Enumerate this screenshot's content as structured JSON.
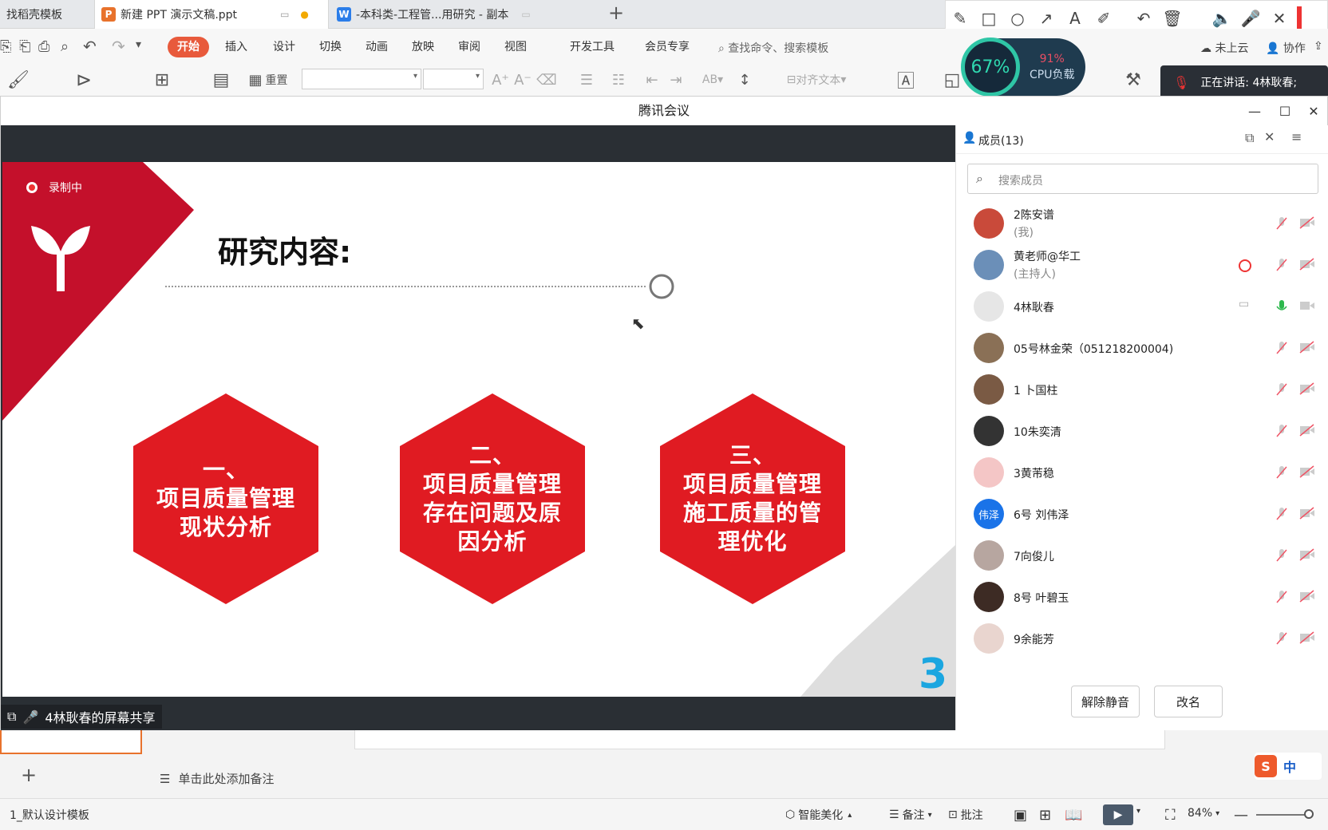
{
  "tabs": [
    {
      "label": "找稻壳模板"
    },
    {
      "label": "新建 PPT 演示文稿.ppt",
      "icon": "P"
    },
    {
      "label": "-本科类-工程管...用研究 - 副本",
      "icon": "W"
    }
  ],
  "menu": [
    "开始",
    "插入",
    "设计",
    "切换",
    "动画",
    "放映",
    "审阅",
    "视图",
    "开发工具",
    "会员专享"
  ],
  "search_cmd": "查找命令、搜索模板",
  "cloud": "未上云",
  "collab": "协作",
  "ribbon": {
    "reset": "重置",
    "align_text": "对齐文本"
  },
  "cpu": {
    "percent": "67%",
    "load": "91%",
    "load_label": "CPU负载"
  },
  "speaking": "正在讲话: 4林耿春;",
  "meeting": {
    "title": "腾讯会议",
    "recording": "录制中",
    "share_label": "4林耿春的屏幕共享"
  },
  "slide": {
    "title": "研究内容:",
    "page_number": "3",
    "hexes": [
      {
        "l1": "一、",
        "l2": "项目质量管理",
        "l3": "现状分析",
        "l4": ""
      },
      {
        "l1": "二、",
        "l2": "项目质量管理",
        "l3": "存在问题及原",
        "l4": "因分析"
      },
      {
        "l1": "三、",
        "l2": "项目质量管理",
        "l3": "施工质量的管",
        "l4": "理优化"
      }
    ]
  },
  "members_panel": {
    "header": "成员(13)",
    "search_placeholder": "搜索成员",
    "unmute": "解除静音",
    "rename": "改名",
    "members": [
      {
        "name": "2陈安谱",
        "sub": "(我)"
      },
      {
        "name": "黄老师@华工",
        "sub": "(主持人)"
      },
      {
        "name": "4林耿春",
        "sub": ""
      },
      {
        "name": "05号林金荣（051218200004)",
        "sub": ""
      },
      {
        "name": "1 卜国柱",
        "sub": ""
      },
      {
        "name": "10朱奕清",
        "sub": ""
      },
      {
        "name": "3黄芾稳",
        "sub": ""
      },
      {
        "name": "6号 刘伟泽",
        "sub": "",
        "avatar_text": "伟泽"
      },
      {
        "name": "7向俊儿",
        "sub": ""
      },
      {
        "name": "8号 叶碧玉",
        "sub": ""
      },
      {
        "name": "9余能芳",
        "sub": ""
      }
    ]
  },
  "notes_placeholder": "单击此处添加备注",
  "status": {
    "template": "1_默认设计模板",
    "beautify": "智能美化",
    "notes": "备注",
    "comments": "批注",
    "zoom": "84%"
  },
  "ime": {
    "lang": "中"
  }
}
